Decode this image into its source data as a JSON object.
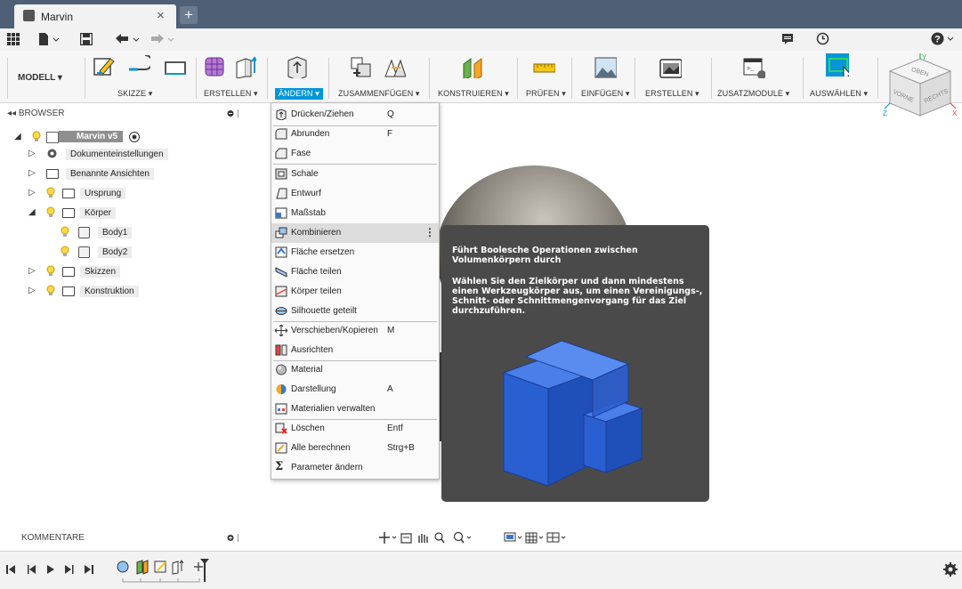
{
  "tab": {
    "title": "Marvin",
    "close": "×",
    "new": "+"
  },
  "ribbon": {
    "mode": "MODELL ▾",
    "groups": [
      {
        "label": "SKIZZE ▾"
      },
      {
        "label": "ERSTELLEN ▾"
      },
      {
        "label": "ÄNDERN ▾"
      },
      {
        "label": "ZUSAMMENFÜGEN ▾"
      },
      {
        "label": "KONSTRUIEREN ▾"
      },
      {
        "label": "PRÜFEN ▾"
      },
      {
        "label": "EINFÜGEN ▾"
      },
      {
        "label": "ERSTELLEN ▾"
      },
      {
        "label": "ZUSATZMODULE ▾"
      },
      {
        "label": "AUSWÄHLEN ▾"
      }
    ]
  },
  "viewcube": {
    "top": "OBEN",
    "front": "VORNE",
    "right": "RECHTS",
    "x": "X",
    "y": "Y",
    "z": "Z"
  },
  "browser": {
    "title": "BROWSER",
    "root": "Marvin v5",
    "items": [
      {
        "label": "Dokumenteinstellungen"
      },
      {
        "label": "Benannte Ansichten"
      },
      {
        "label": "Ursprung"
      },
      {
        "label": "Körper"
      },
      {
        "label": "Body1"
      },
      {
        "label": "Body2"
      },
      {
        "label": "Skizzen"
      },
      {
        "label": "Konstruktion"
      }
    ]
  },
  "menu": {
    "items": [
      {
        "label": "Drücken/Ziehen",
        "key": "Q"
      },
      {
        "label": "Abrunden",
        "key": "F"
      },
      {
        "label": "Fase",
        "key": ""
      },
      {
        "label": "Schale",
        "key": ""
      },
      {
        "label": "Entwurf",
        "key": ""
      },
      {
        "label": "Maßstab",
        "key": ""
      },
      {
        "label": "Kombinieren",
        "key": ""
      },
      {
        "label": "Fläche ersetzen",
        "key": ""
      },
      {
        "label": "Fläche teilen",
        "key": ""
      },
      {
        "label": "Körper teilen",
        "key": ""
      },
      {
        "label": "Silhouette geteilt",
        "key": ""
      },
      {
        "label": "Verschieben/Kopieren",
        "key": "M"
      },
      {
        "label": "Ausrichten",
        "key": ""
      },
      {
        "label": "Material",
        "key": ""
      },
      {
        "label": "Darstellung",
        "key": "A"
      },
      {
        "label": "Materialien verwalten",
        "key": ""
      },
      {
        "label": "Löschen",
        "key": "Entf"
      },
      {
        "label": "Alle berechnen",
        "key": "Strg+B"
      },
      {
        "label": "Parameter ändern",
        "key": ""
      }
    ]
  },
  "tooltip": {
    "title": "Führt Boolesche Operationen zwischen Volumenkörpern durch",
    "body": "Wählen Sie den Zielkörper und dann mindestens einen Werkzeugkörper aus, um einen Vereinigungs-, Schnitt- oder Schnittmengenvorgang für das Ziel durchzuführen."
  },
  "comments": {
    "title": "KOMMENTARE"
  },
  "colors": {
    "accent": "#0696d7",
    "tabbar": "#4f5f75",
    "tooltip": "#4a4a4a",
    "body_blue": "#2a5fd1"
  }
}
